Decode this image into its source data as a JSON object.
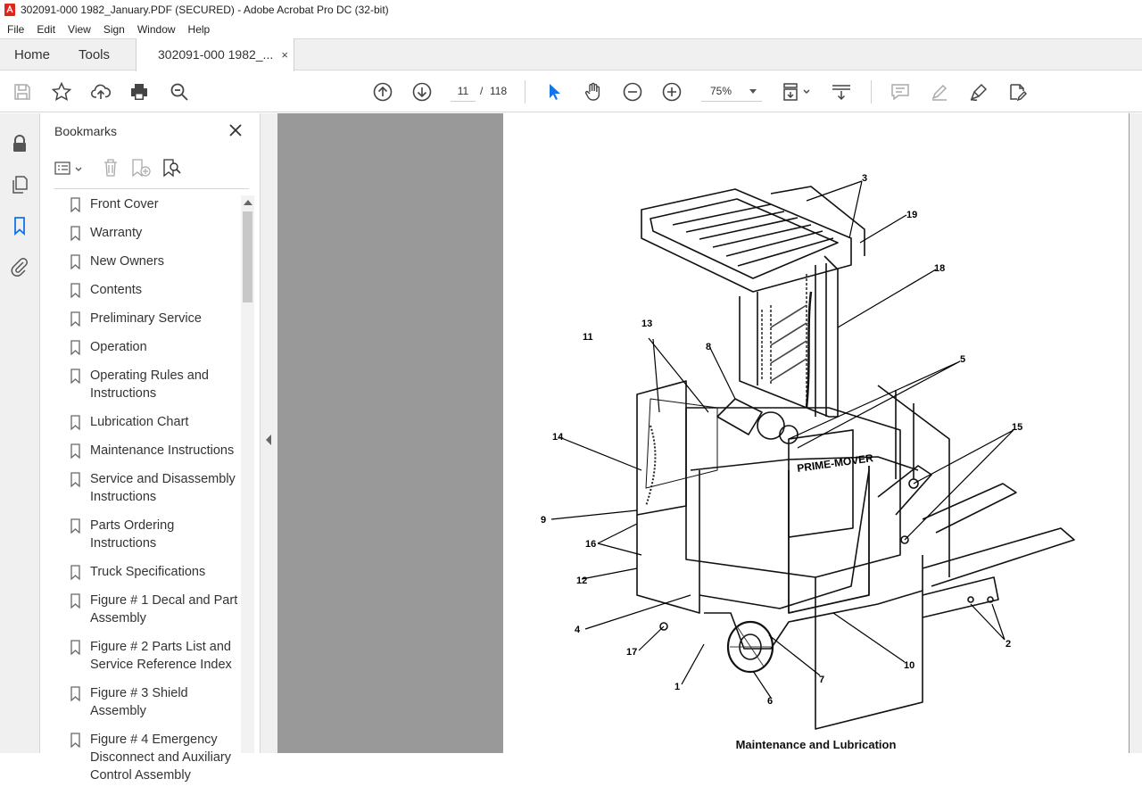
{
  "window": {
    "title": "302091-000 1982_January.PDF (SECURED) - Adobe Acrobat Pro DC (32-bit)"
  },
  "menu": [
    "File",
    "Edit",
    "View",
    "Sign",
    "Window",
    "Help"
  ],
  "tabs": {
    "home": "Home",
    "tools": "Tools",
    "document": "302091-000 1982_...",
    "close": "×"
  },
  "toolbar": {
    "page_current": "11",
    "page_sep": "/",
    "page_total": "118",
    "zoom": "75%"
  },
  "bookmarks": {
    "title": "Bookmarks",
    "items": [
      "Front Cover",
      "Warranty",
      "New Owners",
      "Contents",
      "Preliminary Service",
      "Operation",
      "Operating Rules and Instructions",
      "Lubrication Chart",
      "Maintenance Instructions",
      "Service and Disassembly Instructions",
      "Parts Ordering Instructions",
      "Truck Specifications",
      "Figure # 1 Decal and Part Assembly",
      "Figure # 2 Parts List and Service Reference Index",
      "Figure # 3 Shield Assembly",
      "Figure # 4 Emergency Disconnect and Auxiliary Control Assembly"
    ]
  },
  "document": {
    "caption": "Maintenance and Lubrication",
    "brand_label": "PRIME-MOVER",
    "callouts": [
      "1",
      "2",
      "3",
      "4",
      "5",
      "6",
      "7",
      "8",
      "9",
      "10",
      "11",
      "12",
      "13",
      "14",
      "15",
      "16",
      "17",
      "18",
      "19"
    ]
  },
  "colors": {
    "accent_blue": "#1473e6",
    "viewer_bg": "#999999",
    "app_icon": "#e0261b"
  }
}
